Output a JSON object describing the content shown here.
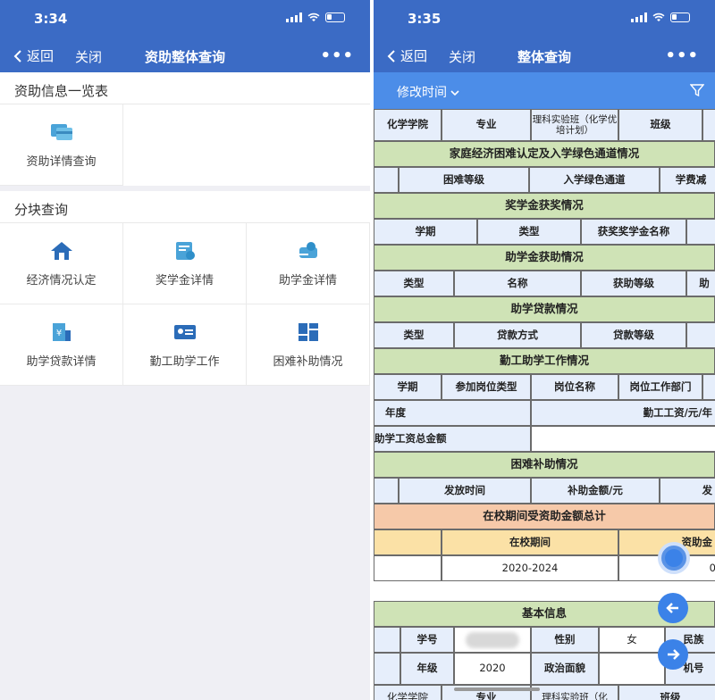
{
  "left": {
    "status_time": "3:34",
    "nav": {
      "back": "返回",
      "close": "关闭",
      "title": "资助整体查询",
      "more": "•••"
    },
    "section1": {
      "title": "资助信息一览表",
      "items": [
        {
          "label": "资助详情查询",
          "icon": "card-icon"
        }
      ]
    },
    "section2": {
      "title": "分块查询",
      "items": [
        {
          "label": "经济情况认定",
          "icon": "house-icon"
        },
        {
          "label": "奖学金详情",
          "icon": "certificate-icon"
        },
        {
          "label": "助学金详情",
          "icon": "hand-coin-icon"
        },
        {
          "label": "助学贷款详情",
          "icon": "yen-building-icon"
        },
        {
          "label": "勤工助学工作",
          "icon": "id-card-icon"
        },
        {
          "label": "困难补助情况",
          "icon": "dashboard-icon"
        }
      ]
    }
  },
  "right": {
    "status_time": "3:35",
    "nav": {
      "back": "返回",
      "close": "关闭",
      "title": "整体查询",
      "more": "•••"
    },
    "filter": {
      "sort_label": "修改时间"
    },
    "table": {
      "r1": [
        "化学学院",
        "专业",
        "理科实验班（化学优培计划）",
        "班级",
        ""
      ],
      "r2": "家庭经济困难认定及入学绿色通道情况",
      "r3": [
        "",
        "困难等级",
        "入学绿色通道",
        "学费减"
      ],
      "r4": "奖学金获奖情况",
      "r5": [
        "学期",
        "类型",
        "获奖奖学金名称",
        ""
      ],
      "r6": "助学金获助情况",
      "r7": [
        "类型",
        "名称",
        "获助等级",
        "助"
      ],
      "r8": "助学贷款情况",
      "r9": [
        "类型",
        "贷款方式",
        "贷款等级",
        ""
      ],
      "r10": "勤工助学工作情况",
      "r11": [
        "学期",
        "参加岗位类型",
        "岗位名称",
        "岗位工作部门",
        ""
      ],
      "r12": [
        "年度",
        "勤工工资/元/年"
      ],
      "r13": [
        "助学工资总金额",
        ""
      ],
      "r14": "困难补助情况",
      "r15": [
        "",
        "发放时间",
        "补助金额/元",
        "发"
      ],
      "r16": "在校期间受资助金额总计",
      "r17": [
        "",
        "在校期间",
        "资助金"
      ],
      "r18": [
        "",
        "2020-2024",
        "0"
      ],
      "r19": "基本信息",
      "r20": [
        "",
        "学号",
        "",
        "性别",
        "女",
        "民族"
      ],
      "r21": [
        "",
        "年级",
        "2020",
        "政治面貌",
        "",
        "机号"
      ],
      "r22": [
        "化学学院",
        "专业",
        "理科实验班（化",
        "班级"
      ]
    }
  },
  "colors": {
    "nav": "#3b6bc5",
    "filter": "#4c8de8",
    "header_green": "#cfe3b6",
    "cell_blue": "#e6eefb",
    "orange": "#f6c9a9",
    "yellow": "#fbe1a6"
  }
}
